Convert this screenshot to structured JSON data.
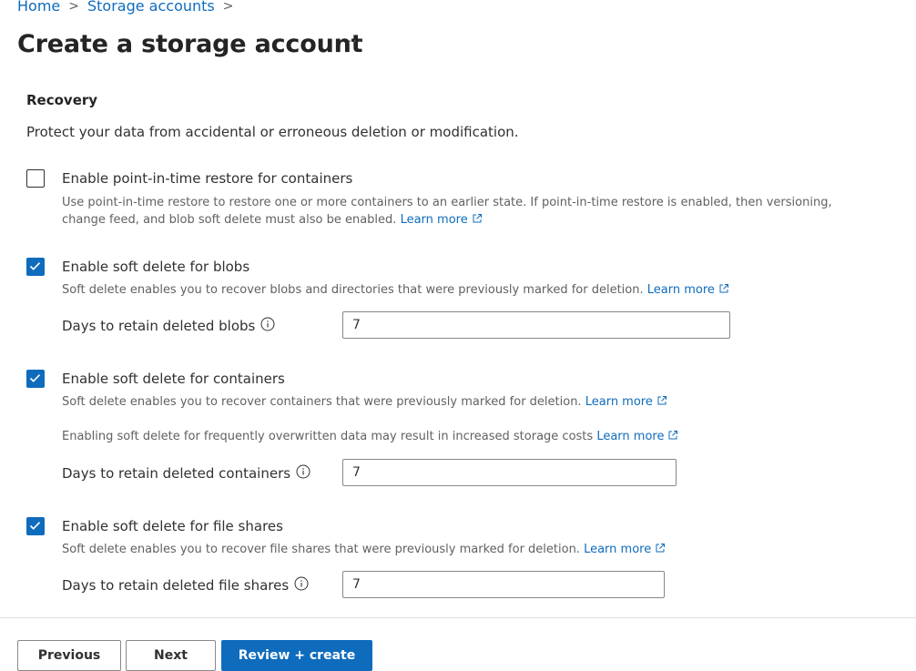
{
  "breadcrumb": {
    "home": "Home",
    "storage": "Storage accounts",
    "sep": ">"
  },
  "page": {
    "title": "Create a storage account",
    "more": "···"
  },
  "recovery": {
    "title": "Recovery",
    "description": "Protect your data from accidental or erroneous deletion or modification.",
    "pitr": {
      "checked": false,
      "label": "Enable point-in-time restore for containers",
      "help_line1": "Use point-in-time restore to restore one or more containers to an earlier state. If point-in-time restore is enabled, then versioning,",
      "help_line2": "change feed, and blob soft delete must also be enabled.",
      "learn_more": "Learn more"
    },
    "blobs": {
      "checked": true,
      "label": "Enable soft delete for blobs",
      "help": "Soft delete enables you to recover blobs and directories that were previously marked for deletion.",
      "learn_more": "Learn more",
      "days_label": "Days to retain deleted blobs",
      "days_value": "7"
    },
    "containers": {
      "checked": true,
      "label": "Enable soft delete for containers",
      "help": "Soft delete enables you to recover containers that were previously marked for deletion.",
      "learn_more": "Learn more",
      "warning": "Enabling soft delete for frequently overwritten data may result in increased storage costs",
      "warning_learn_more": "Learn more",
      "days_label": "Days to retain deleted containers",
      "days_value": "7"
    },
    "file_shares": {
      "checked": true,
      "label": "Enable soft delete for file shares",
      "help": "Soft delete enables you to recover file shares that were previously marked for deletion.",
      "learn_more": "Learn more",
      "days_label": "Days to retain deleted file shares",
      "days_value": "7"
    }
  },
  "footer": {
    "previous": "Previous",
    "next": "Next",
    "review_create": "Review + create"
  },
  "colors": {
    "accent": "#0f6cbd",
    "text": "#323130",
    "muted": "#616161",
    "border": "#8a8886"
  },
  "icons": {
    "checkbox_check": "checkmark-icon",
    "external": "external-link-icon",
    "info": "info-icon",
    "chevron": "chevron-right-icon"
  }
}
